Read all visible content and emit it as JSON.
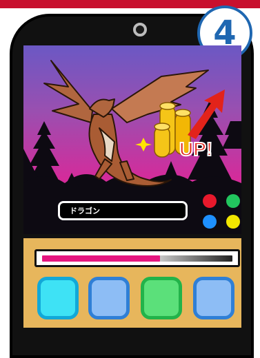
{
  "header": {
    "step_number": "4"
  },
  "screen": {
    "creature_icon": "dragon-icon",
    "bonus_icon": "coin-stack-icon",
    "trend_icon": "red-up-arrow-icon",
    "bonus_text": "UP!",
    "creature_name": "ドラゴン"
  },
  "color_dots": [
    {
      "name": "red",
      "color": "#e8192c"
    },
    {
      "name": "green",
      "color": "#22c55e"
    },
    {
      "name": "blue",
      "color": "#1e90ff"
    },
    {
      "name": "yellow",
      "color": "#f2e600"
    }
  ],
  "hp_bar": {
    "fill_fraction": 0.62,
    "fill_color": "#e5167f"
  },
  "buttons": [
    {
      "name": "cyan",
      "color": "#3ee2f5",
      "border": "#12a8d8"
    },
    {
      "name": "light-blue-1",
      "color": "#8dbdf5",
      "border": "#2f7fd6"
    },
    {
      "name": "green",
      "color": "#5be07a",
      "border": "#22b34a"
    },
    {
      "name": "light-blue-2",
      "color": "#8dbdf5",
      "border": "#2f7fd6"
    }
  ],
  "theme": {
    "accent_red": "#c8102e",
    "badge_blue": "#1f67b1",
    "panel": "#e7b65c"
  }
}
